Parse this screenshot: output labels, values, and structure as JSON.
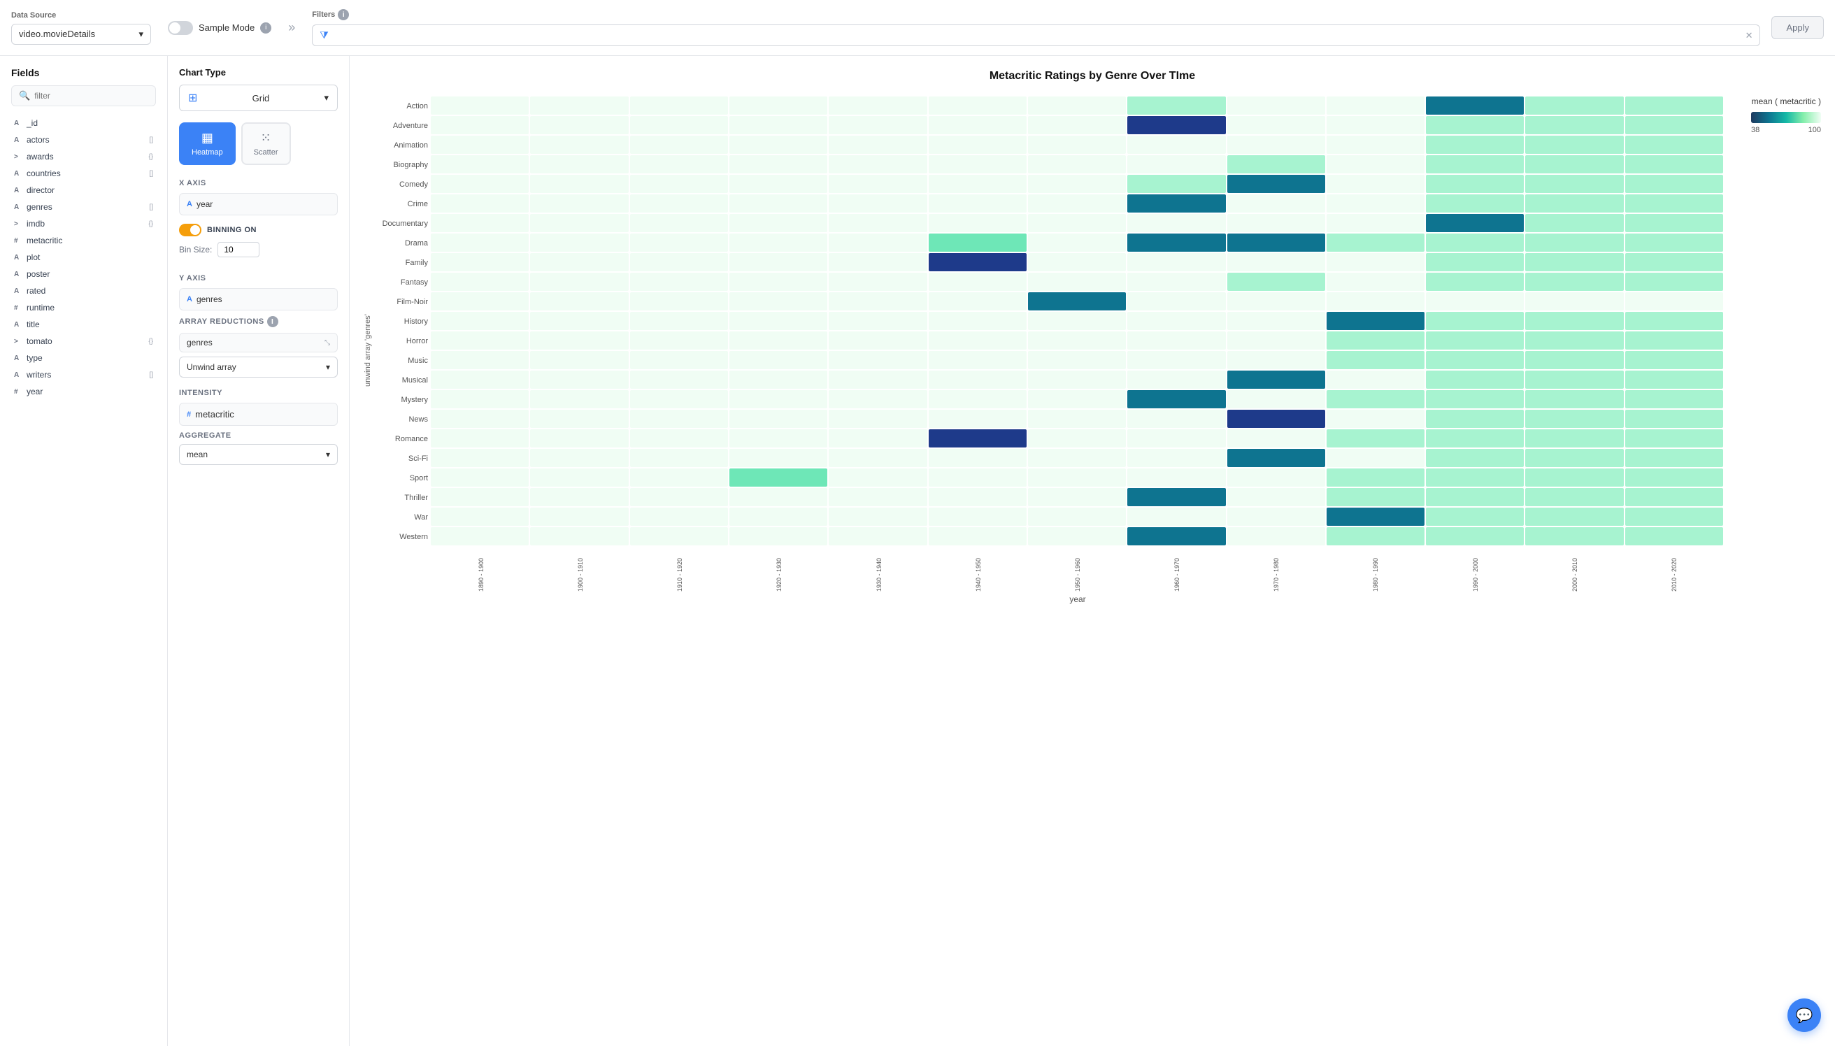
{
  "topBar": {
    "dataSourceLabel": "Data Source",
    "dataSourceValue": "video.movieDetails",
    "sampleModeLabel": "Sample Mode",
    "filtersLabel": "Filters",
    "applyLabel": "Apply"
  },
  "sidebar": {
    "title": "Fields",
    "searchPlaceholder": "filter",
    "fields": [
      {
        "name": "_id",
        "type": "A",
        "badge": ""
      },
      {
        "name": "actors",
        "type": "A",
        "badge": "[]"
      },
      {
        "name": "awards",
        "type": ">",
        "badge": "{}"
      },
      {
        "name": "countries",
        "type": "A",
        "badge": "[]"
      },
      {
        "name": "director",
        "type": "A",
        "badge": ""
      },
      {
        "name": "genres",
        "type": "A",
        "badge": "[]"
      },
      {
        "name": "imdb",
        "type": ">",
        "badge": "{}"
      },
      {
        "name": "metacritic",
        "type": "#",
        "badge": ""
      },
      {
        "name": "plot",
        "type": "A",
        "badge": ""
      },
      {
        "name": "poster",
        "type": "A",
        "badge": ""
      },
      {
        "name": "rated",
        "type": "A",
        "badge": ""
      },
      {
        "name": "runtime",
        "type": "#",
        "badge": ""
      },
      {
        "name": "title",
        "type": "A",
        "badge": ""
      },
      {
        "name": "tomato",
        "type": ">",
        "badge": "{}"
      },
      {
        "name": "type",
        "type": "A",
        "badge": ""
      },
      {
        "name": "writers",
        "type": "A",
        "badge": "[]"
      },
      {
        "name": "year",
        "type": "#",
        "badge": ""
      }
    ]
  },
  "chartPanel": {
    "chartTypeLabel": "Chart Type",
    "chartTypeValue": "Grid",
    "buttons": [
      {
        "id": "heatmap",
        "label": "Heatmap",
        "active": true
      },
      {
        "id": "scatter",
        "label": "Scatter",
        "active": false
      }
    ],
    "xAxis": {
      "label": "X Axis",
      "fieldName": "year",
      "fieldType": "A",
      "binningLabel": "BINNING ON",
      "binSizeLabel": "Bin Size:",
      "binSizeValue": "10"
    },
    "yAxis": {
      "label": "Y Axis",
      "fieldName": "genres",
      "fieldType": "A",
      "arrayReductionsLabel": "ARRAY REDUCTIONS",
      "reductionFieldName": "genres",
      "reductionMethod": "Unwind array"
    },
    "intensity": {
      "label": "Intensity",
      "fieldName": "metacritic",
      "fieldType": "#",
      "aggregateLabel": "AGGREGATE",
      "aggregateValue": "mean"
    }
  },
  "chart": {
    "title": "Metacritic Ratings by Genre Over TIme",
    "yAxisLabel": "unwind array 'genres'",
    "xAxisTitle": "year",
    "legendTitle": "mean ( metacritic )",
    "legendMin": "38",
    "legendMax": "100",
    "genres": [
      "Action",
      "Adventure",
      "Animation",
      "Biography",
      "Comedy",
      "Crime",
      "Documentary",
      "Drama",
      "Family",
      "Fantasy",
      "Film-Noir",
      "History",
      "Horror",
      "Music",
      "Musical",
      "Mystery",
      "News",
      "Romance",
      "Sci-Fi",
      "Sport",
      "Thriller",
      "War",
      "Western"
    ],
    "xLabels": [
      "1890 - 1900",
      "1900 - 1910",
      "1910 - 1920",
      "1920 - 1930",
      "1930 - 1940",
      "1940 - 1950",
      "1950 - 1960",
      "1960 - 1970",
      "1970 - 1980",
      "1980 - 1990",
      "1990 - 2000",
      "2000 - 2010",
      "2010 - 2020"
    ],
    "rows": [
      [
        0,
        0,
        0,
        0,
        0,
        0,
        0,
        3,
        0,
        0,
        4,
        3,
        3
      ],
      [
        0,
        0,
        0,
        0,
        0,
        0,
        0,
        5,
        0,
        0,
        3,
        3,
        3
      ],
      [
        0,
        0,
        0,
        0,
        0,
        0,
        0,
        0,
        0,
        0,
        3,
        3,
        3
      ],
      [
        0,
        0,
        0,
        0,
        0,
        0,
        0,
        0,
        3,
        0,
        3,
        3,
        3
      ],
      [
        0,
        0,
        0,
        0,
        0,
        0,
        0,
        3,
        4,
        0,
        3,
        3,
        3
      ],
      [
        0,
        0,
        0,
        0,
        0,
        0,
        0,
        4,
        0,
        0,
        3,
        3,
        3
      ],
      [
        0,
        0,
        0,
        0,
        0,
        0,
        0,
        0,
        0,
        0,
        4,
        3,
        3
      ],
      [
        0,
        0,
        0,
        0,
        0,
        1,
        0,
        4,
        4,
        3,
        3,
        3,
        3
      ],
      [
        0,
        0,
        0,
        0,
        0,
        5,
        0,
        0,
        0,
        0,
        3,
        3,
        3
      ],
      [
        0,
        0,
        0,
        0,
        0,
        0,
        0,
        0,
        3,
        0,
        3,
        3,
        3
      ],
      [
        0,
        0,
        0,
        0,
        0,
        0,
        4,
        0,
        0,
        0,
        0,
        0,
        0
      ],
      [
        0,
        0,
        0,
        0,
        0,
        0,
        0,
        0,
        0,
        4,
        3,
        3,
        3
      ],
      [
        0,
        0,
        0,
        0,
        0,
        0,
        0,
        0,
        0,
        3,
        3,
        3,
        3
      ],
      [
        0,
        0,
        0,
        0,
        0,
        0,
        0,
        0,
        0,
        3,
        3,
        3,
        3
      ],
      [
        0,
        0,
        0,
        0,
        0,
        0,
        0,
        0,
        4,
        0,
        3,
        3,
        3
      ],
      [
        0,
        0,
        0,
        0,
        0,
        0,
        0,
        4,
        0,
        3,
        3,
        3,
        3
      ],
      [
        0,
        0,
        0,
        0,
        0,
        0,
        0,
        0,
        5,
        0,
        3,
        3,
        3
      ],
      [
        0,
        0,
        0,
        0,
        0,
        5,
        0,
        0,
        0,
        3,
        3,
        3,
        3
      ],
      [
        0,
        0,
        0,
        0,
        0,
        0,
        0,
        0,
        4,
        0,
        3,
        3,
        3
      ],
      [
        0,
        0,
        0,
        1,
        0,
        0,
        0,
        0,
        0,
        3,
        3,
        3,
        3
      ],
      [
        0,
        0,
        0,
        0,
        0,
        0,
        0,
        4,
        0,
        3,
        3,
        3,
        3
      ],
      [
        0,
        0,
        0,
        0,
        0,
        0,
        0,
        0,
        0,
        4,
        3,
        3,
        3
      ],
      [
        0,
        0,
        0,
        0,
        0,
        0,
        0,
        4,
        0,
        3,
        3,
        3,
        3
      ]
    ]
  },
  "chatButton": {
    "label": "💬"
  }
}
